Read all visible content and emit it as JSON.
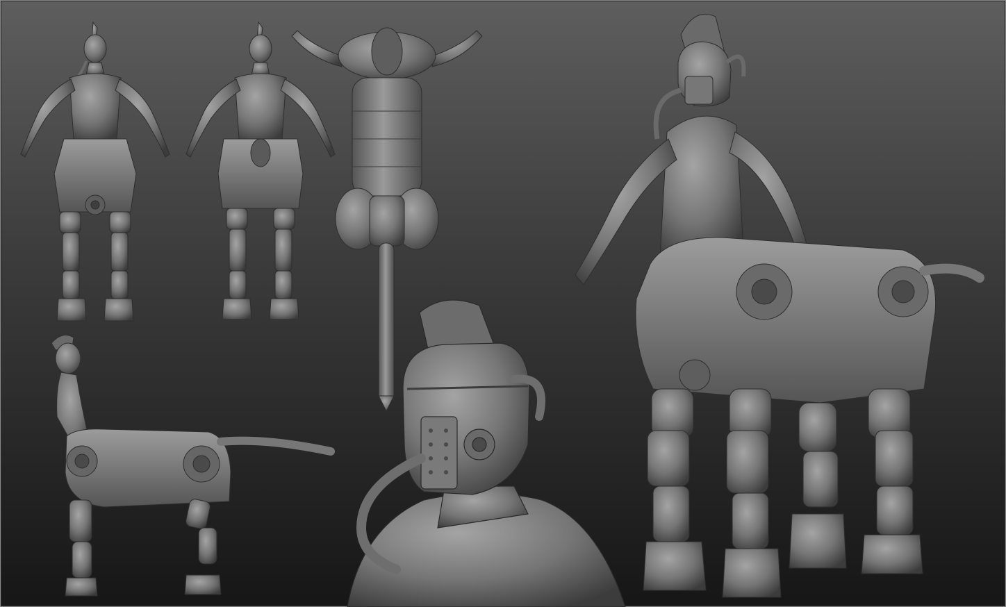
{
  "sheet": {
    "description_visible_text": "",
    "palette": {
      "clay_light": "#9a9a9a",
      "clay_mid": "#6f6f6f",
      "clay_dark": "#3a3a3a",
      "bg_top": "#5e5e5e",
      "bg_bottom": "#161616"
    },
    "views": [
      {
        "id": "front",
        "icon": "centaur-front-view"
      },
      {
        "id": "back",
        "icon": "centaur-back-view"
      },
      {
        "id": "top",
        "icon": "centaur-top-view"
      },
      {
        "id": "side",
        "icon": "centaur-side-view"
      },
      {
        "id": "helmet-closeup",
        "icon": "helmet-closeup"
      },
      {
        "id": "three-quarter",
        "icon": "centaur-three-quarter-view"
      }
    ]
  }
}
